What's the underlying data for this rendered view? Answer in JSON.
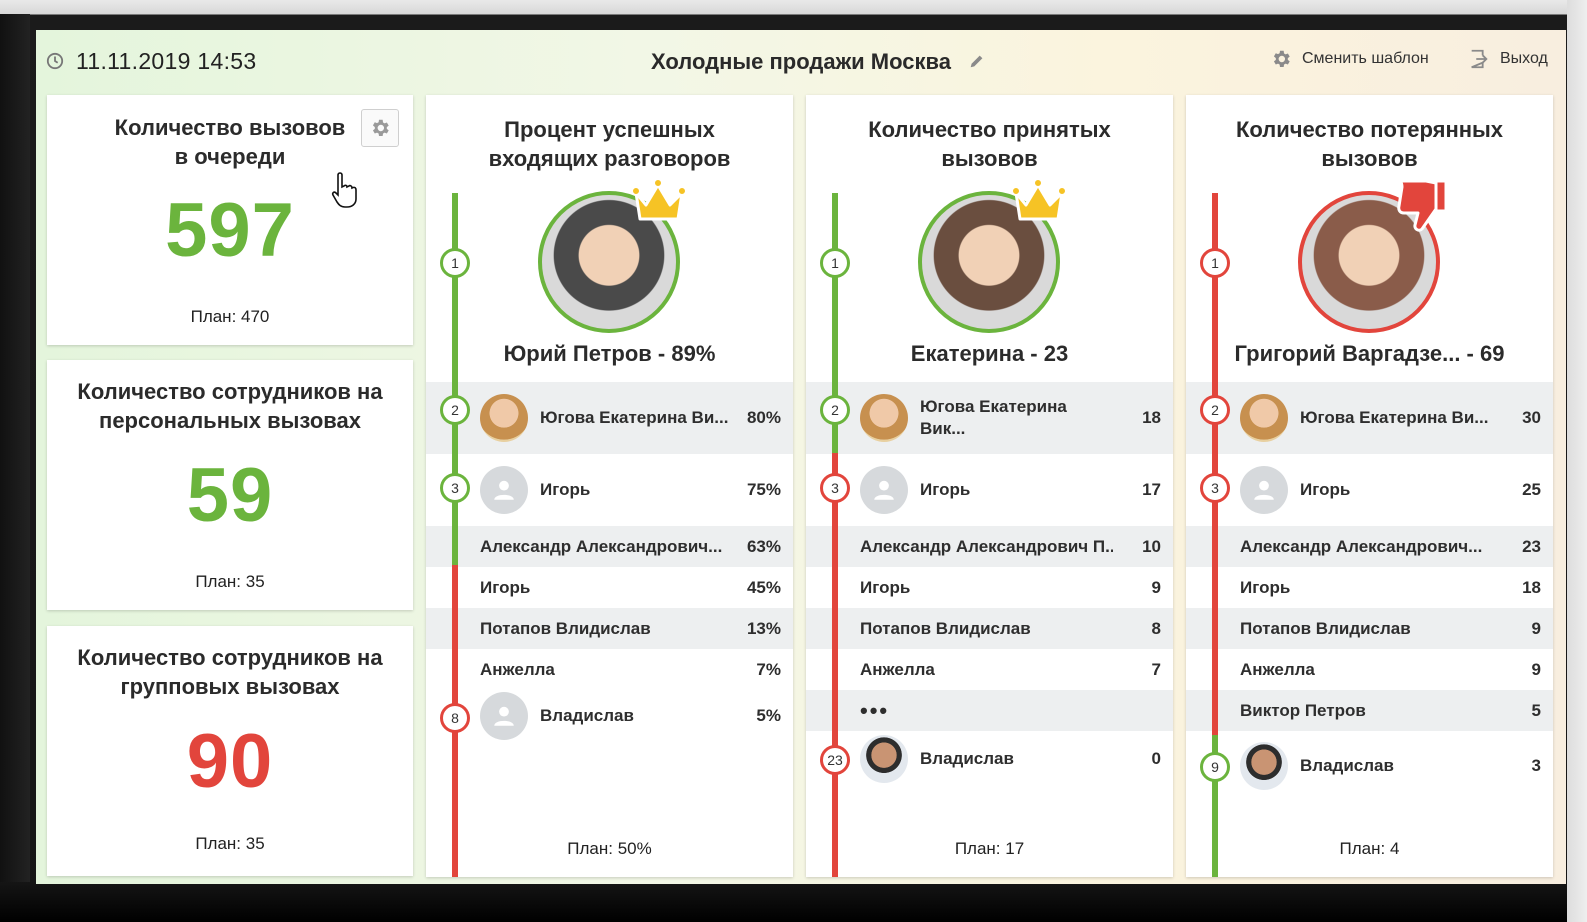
{
  "header": {
    "datetime": "11.11.2019 14:53",
    "title": "Холодные продажи Москва",
    "change_template": "Сменить шаблон",
    "logout": "Выход"
  },
  "kpis": [
    {
      "title": "Количество вызовов\nв очереди",
      "value": "597",
      "plan": "План: 470",
      "color": "#6bb43d"
    },
    {
      "title": "Количество сотрудников на\nперсональных вызовах",
      "value": "59",
      "plan": "План: 35",
      "color": "#6bb43d"
    },
    {
      "title": "Количество сотрудников на\nгрупповых вызовах",
      "value": "90",
      "plan": "План: 35",
      "color": "#e2453c"
    }
  ],
  "columns": [
    {
      "title": "Процент успешных\nвходящих разговоров",
      "leader": "Юрий Петров - 89%",
      "leader_badge": "crown-icon",
      "plan": "План: 50%",
      "rows": [
        {
          "rank": "2",
          "name": "Югова Екатерина Ви...",
          "value": "80%"
        },
        {
          "rank": "3",
          "name": "Игорь",
          "value": "75%"
        },
        {
          "name": "Александр Александрович...",
          "value": "63%"
        },
        {
          "name": "Игорь",
          "value": "45%"
        },
        {
          "name": "Потапов Влидислав",
          "value": "13%"
        },
        {
          "name": "Анжелла",
          "value": "7%"
        },
        {
          "rank": "8",
          "name": "Владислав",
          "value": "5%"
        }
      ]
    },
    {
      "title": "Количество принятых\nвызовов",
      "leader": "Екатерина - 23",
      "leader_badge": "crown-icon",
      "plan": "План: 17",
      "rows": [
        {
          "rank": "2",
          "name": "Югова Екатерина\nВик...",
          "value": "18"
        },
        {
          "rank": "3",
          "name": "Игорь",
          "value": "17"
        },
        {
          "name": "Александр Александрович П...",
          "value": "10"
        },
        {
          "name": "Игорь",
          "value": "9"
        },
        {
          "name": "Потапов Влидислав",
          "value": "8"
        },
        {
          "name": "Анжелла",
          "value": "7"
        },
        {
          "name": "•••",
          "value": ""
        },
        {
          "rank": "23",
          "name": "Владислав",
          "value": "0"
        }
      ]
    },
    {
      "title": "Количество потерянных\nвызовов",
      "leader": "Григорий Варгадзе... - 69",
      "leader_badge": "thumbs-down-icon",
      "plan": "План: 4",
      "rows": [
        {
          "rank": "2",
          "name": "Югова Екатерина Ви...",
          "value": "30"
        },
        {
          "rank": "3",
          "name": "Игорь",
          "value": "25"
        },
        {
          "name": "Александр Александрович...",
          "value": "23"
        },
        {
          "name": "Игорь",
          "value": "18"
        },
        {
          "name": "Потапов Влидислав",
          "value": "9"
        },
        {
          "name": "Анжелла",
          "value": "9"
        },
        {
          "name": "Виктор Петров",
          "value": "5"
        },
        {
          "rank": "9",
          "name": "Владислав",
          "value": "3"
        }
      ]
    }
  ],
  "colors": {
    "green": "#6bb43d",
    "red": "#e2453c",
    "shade": "#edeff0"
  }
}
